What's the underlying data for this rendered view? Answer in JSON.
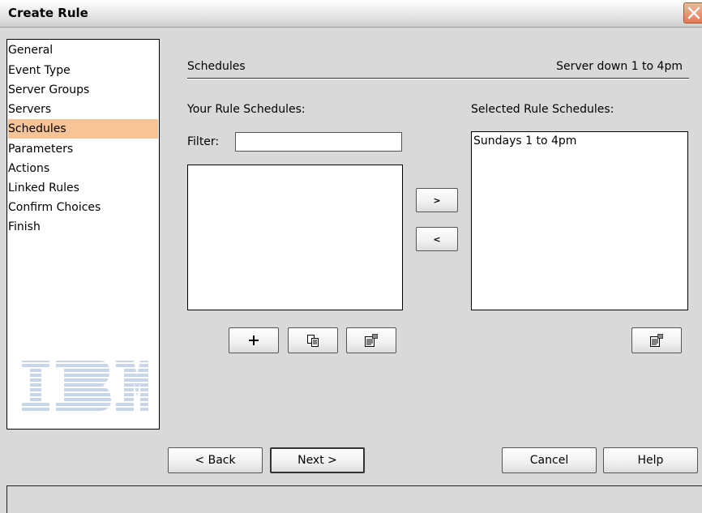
{
  "window": {
    "title": "Create Rule",
    "close_icon": "close-icon"
  },
  "nav": {
    "items": [
      {
        "label": "General",
        "selected": false
      },
      {
        "label": "Event Type",
        "selected": false
      },
      {
        "label": "Server Groups",
        "selected": false
      },
      {
        "label": "Servers",
        "selected": false
      },
      {
        "label": "Schedules",
        "selected": true
      },
      {
        "label": "Parameters",
        "selected": false
      },
      {
        "label": "Actions",
        "selected": false
      },
      {
        "label": "Linked Rules",
        "selected": false
      },
      {
        "label": "Confirm Choices",
        "selected": false
      },
      {
        "label": "Finish",
        "selected": false
      }
    ],
    "selected_color": "#f6c496",
    "logo": "ibm-logo"
  },
  "section": {
    "title": "Schedules",
    "subtitle": "Server down 1 to 4pm"
  },
  "your_schedules": {
    "label": "Your Rule Schedules:",
    "filter_label": "Filter:",
    "filter_value": "",
    "items": []
  },
  "selected_schedules": {
    "label": "Selected Rule Schedules:",
    "items": [
      "Sundays 1 to 4pm"
    ]
  },
  "transfer": {
    "add_label": ">",
    "remove_label": "<"
  },
  "list_actions": {
    "new_icon": "plus-icon",
    "copy_icon": "copy-icon",
    "properties_icon": "properties-icon"
  },
  "footer": {
    "back_label": "< Back",
    "next_label": "Next >",
    "cancel_label": "Cancel",
    "help_label": "Help"
  }
}
